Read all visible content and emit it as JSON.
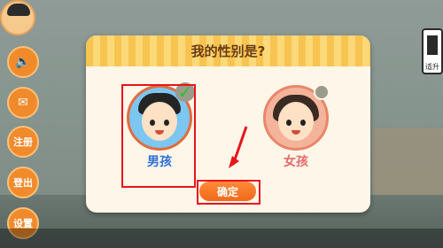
{
  "dialog": {
    "title": "我的性别是?",
    "options": [
      {
        "label": "男孩",
        "selected": true
      },
      {
        "label": "女孩",
        "selected": false
      }
    ],
    "confirm_label": "确定"
  },
  "sidebar": {
    "buttons": [
      {
        "label": "",
        "icon": "speaker-icon"
      },
      {
        "label": "",
        "icon": "mail-icon"
      },
      {
        "label": "注册"
      },
      {
        "label": "登出"
      },
      {
        "label": "设置"
      }
    ]
  },
  "right_panel": {
    "label": "适升"
  },
  "colors": {
    "accent": "#f06a1a",
    "annotation": "#e8141b",
    "boy": "#2f6fd6",
    "girl": "#e56a6a",
    "check": "#2ec02e"
  }
}
